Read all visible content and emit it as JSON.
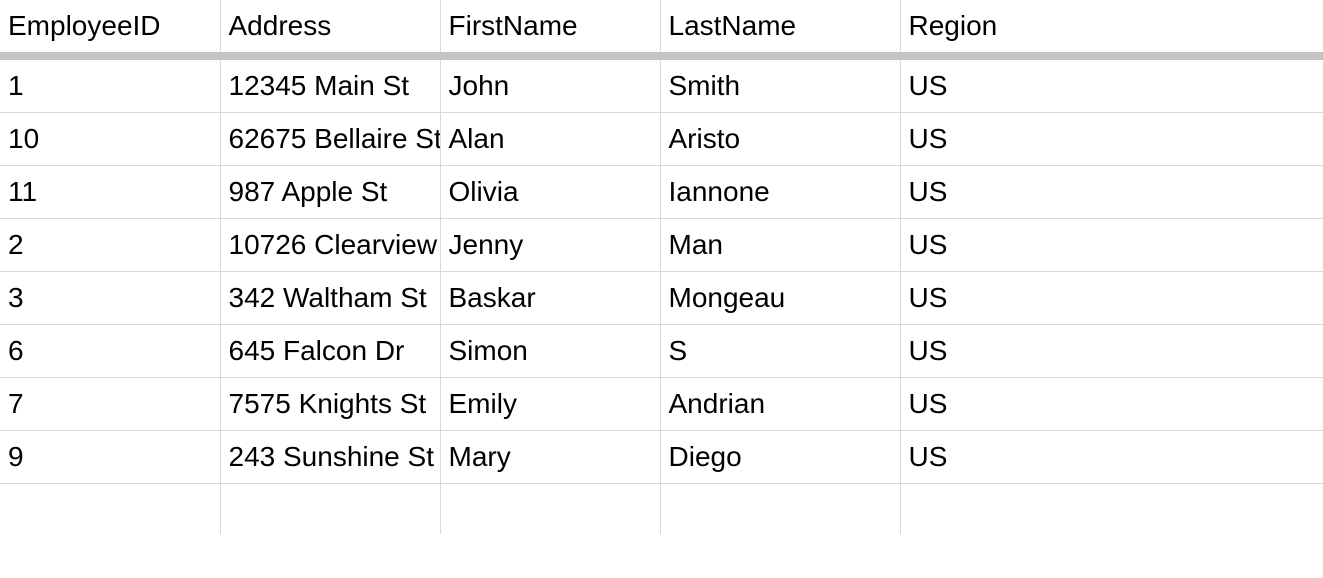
{
  "table": {
    "headers": {
      "employeeId": "EmployeeID",
      "address": "Address",
      "firstName": "FirstName",
      "lastName": "LastName",
      "region": "Region"
    },
    "rows": [
      {
        "employeeId": "1",
        "address": "12345 Main St",
        "firstName": "John",
        "lastName": "Smith",
        "region": "US"
      },
      {
        "employeeId": "10",
        "address": "62675 Bellaire St",
        "firstName": "Alan",
        "lastName": "Aristo",
        "region": "US"
      },
      {
        "employeeId": "11",
        "address": "987 Apple St",
        "firstName": "Olivia",
        "lastName": "Iannone",
        "region": "US"
      },
      {
        "employeeId": "2",
        "address": "10726 Clearview",
        "firstName": "Jenny",
        "lastName": "Man",
        "region": "US"
      },
      {
        "employeeId": "3",
        "address": "342 Waltham St",
        "firstName": "Baskar",
        "lastName": "Mongeau",
        "region": "US"
      },
      {
        "employeeId": "6",
        "address": "645 Falcon Dr",
        "firstName": "Simon",
        "lastName": "S",
        "region": "US"
      },
      {
        "employeeId": "7",
        "address": "7575 Knights St",
        "firstName": "Emily",
        "lastName": "Andrian",
        "region": "US"
      },
      {
        "employeeId": "9",
        "address": "243 Sunshine St",
        "firstName": "Mary",
        "lastName": "Diego",
        "region": "US"
      }
    ]
  }
}
